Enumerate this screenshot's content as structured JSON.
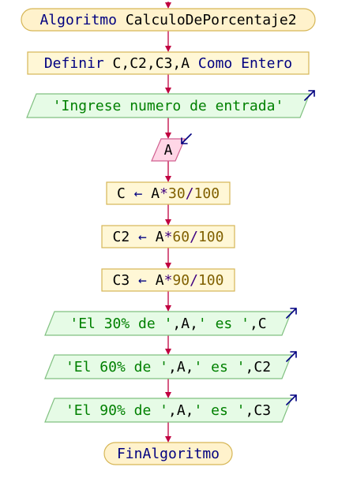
{
  "diagram": {
    "colors": {
      "keyword": "#000080",
      "identifier": "#000000",
      "number": "#806000",
      "string": "#008000",
      "operator": "#400080",
      "arrow": "#c00040",
      "terminal_fill": "#fff2cc",
      "terminal_stroke": "#d6b656",
      "process_fill": "#fff7d6",
      "process_stroke": "#d6b656",
      "io_fill": "#e6fbe6",
      "io_stroke": "#80c080",
      "input_fill": "#ffd6e6",
      "input_stroke": "#d06090"
    },
    "nodes": [
      {
        "id": "start",
        "type": "terminal",
        "io_mark": "",
        "tokens": [
          {
            "text": "Algoritmo ",
            "role": "keyword"
          },
          {
            "text": "CalculoDePorcentaje2",
            "role": "identifier"
          }
        ]
      },
      {
        "id": "define",
        "type": "process",
        "io_mark": "",
        "tokens": [
          {
            "text": "Definir ",
            "role": "keyword"
          },
          {
            "text": "C,C2,C3,A ",
            "role": "identifier"
          },
          {
            "text": "Como Entero",
            "role": "keyword"
          }
        ]
      },
      {
        "id": "prompt",
        "type": "output",
        "io_mark": "out",
        "tokens": [
          {
            "text": "'Ingrese numero de entrada'",
            "role": "string"
          }
        ]
      },
      {
        "id": "read-a",
        "type": "input",
        "io_mark": "in",
        "tokens": [
          {
            "text": "A",
            "role": "identifier"
          }
        ]
      },
      {
        "id": "calc-c",
        "type": "process",
        "io_mark": "",
        "tokens": [
          {
            "text": "C ",
            "role": "identifier"
          },
          {
            "text": "←",
            "role": "keyword"
          },
          {
            "text": " A",
            "role": "identifier"
          },
          {
            "text": "*",
            "role": "operator"
          },
          {
            "text": "30",
            "role": "number"
          },
          {
            "text": "/",
            "role": "operator"
          },
          {
            "text": "100",
            "role": "number"
          }
        ]
      },
      {
        "id": "calc-c2",
        "type": "process",
        "io_mark": "",
        "tokens": [
          {
            "text": "C2 ",
            "role": "identifier"
          },
          {
            "text": "←",
            "role": "keyword"
          },
          {
            "text": " A",
            "role": "identifier"
          },
          {
            "text": "*",
            "role": "operator"
          },
          {
            "text": "60",
            "role": "number"
          },
          {
            "text": "/",
            "role": "operator"
          },
          {
            "text": "100",
            "role": "number"
          }
        ]
      },
      {
        "id": "calc-c3",
        "type": "process",
        "io_mark": "",
        "tokens": [
          {
            "text": "C3 ",
            "role": "identifier"
          },
          {
            "text": "←",
            "role": "keyword"
          },
          {
            "text": " A",
            "role": "identifier"
          },
          {
            "text": "*",
            "role": "operator"
          },
          {
            "text": "90",
            "role": "number"
          },
          {
            "text": "/",
            "role": "operator"
          },
          {
            "text": "100",
            "role": "number"
          }
        ]
      },
      {
        "id": "out-30",
        "type": "output",
        "io_mark": "out",
        "tokens": [
          {
            "text": "'El 30% de '",
            "role": "string"
          },
          {
            "text": ",A,",
            "role": "identifier"
          },
          {
            "text": "' es '",
            "role": "string"
          },
          {
            "text": ",C",
            "role": "identifier"
          }
        ]
      },
      {
        "id": "out-60",
        "type": "output",
        "io_mark": "out",
        "tokens": [
          {
            "text": "'El 60% de '",
            "role": "string"
          },
          {
            "text": ",A,",
            "role": "identifier"
          },
          {
            "text": "' es '",
            "role": "string"
          },
          {
            "text": ",C2",
            "role": "identifier"
          }
        ]
      },
      {
        "id": "out-90",
        "type": "output",
        "io_mark": "out",
        "tokens": [
          {
            "text": "'El 90% de '",
            "role": "string"
          },
          {
            "text": ",A,",
            "role": "identifier"
          },
          {
            "text": "' es '",
            "role": "string"
          },
          {
            "text": ",C3",
            "role": "identifier"
          }
        ]
      },
      {
        "id": "end",
        "type": "terminal",
        "io_mark": "",
        "tokens": [
          {
            "text": "FinAlgoritmo",
            "role": "keyword"
          }
        ]
      }
    ]
  }
}
